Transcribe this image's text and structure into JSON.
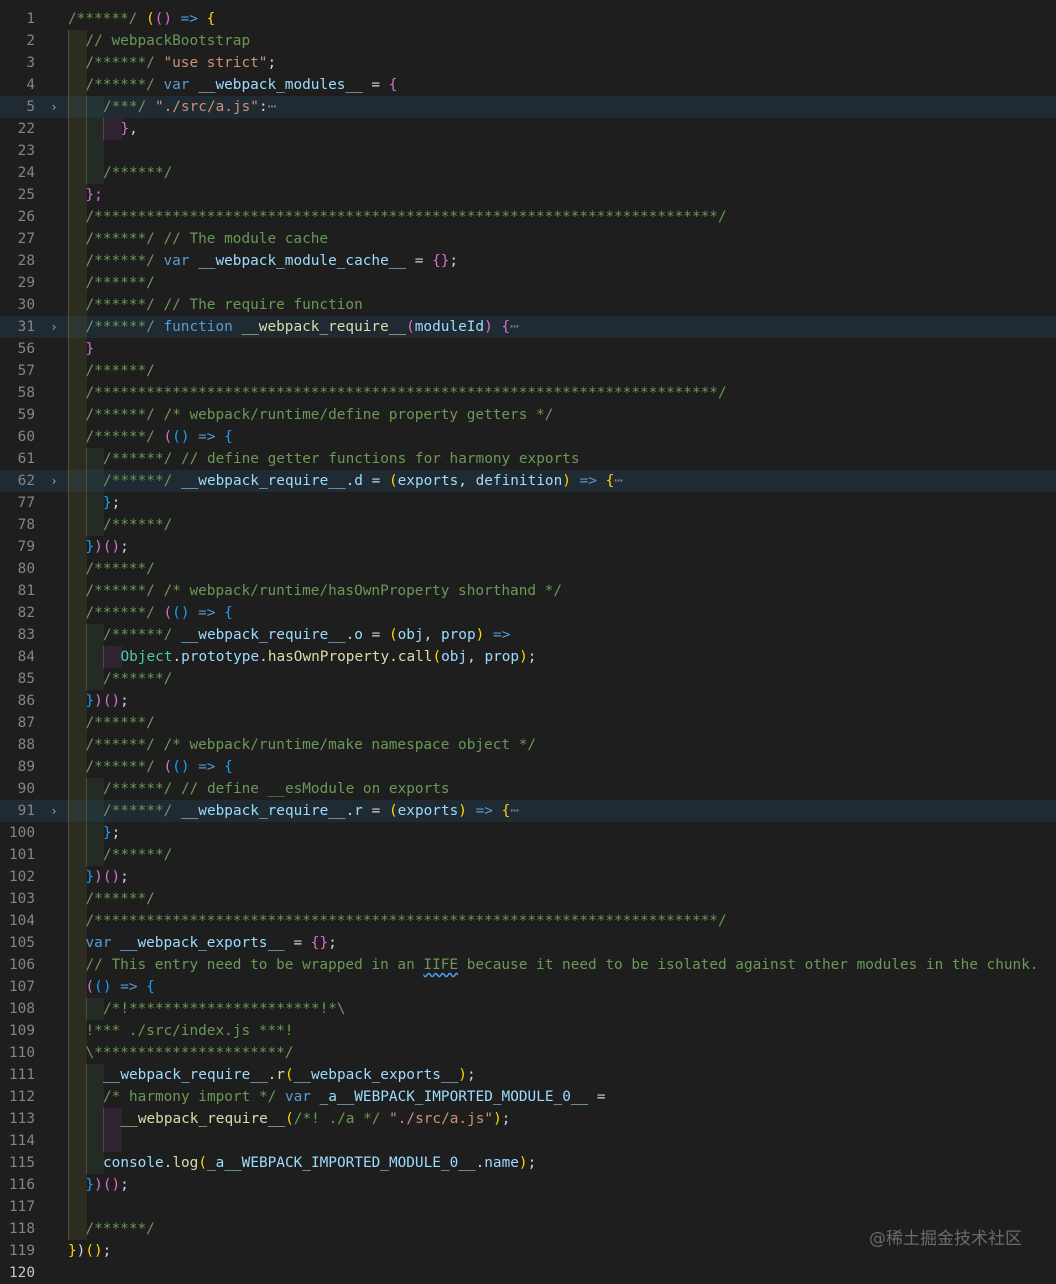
{
  "editor": {
    "lines": [
      {
        "n": "1",
        "fold": false,
        "hl": false,
        "indent": 0,
        "tokens": [
          [
            "/******/ ",
            "cm"
          ],
          [
            "(",
            "p1"
          ],
          [
            "()",
            "p2"
          ],
          [
            " => ",
            "kw"
          ],
          [
            "{",
            "p1"
          ]
        ]
      },
      {
        "n": "2",
        "fold": false,
        "hl": false,
        "indent": 1,
        "tokens": [
          [
            "// webpackBootstrap",
            "cm"
          ]
        ]
      },
      {
        "n": "3",
        "fold": false,
        "hl": false,
        "indent": 1,
        "tokens": [
          [
            "/******/ ",
            "cm"
          ],
          [
            "\"use strict\"",
            "str"
          ],
          [
            ";",
            "op"
          ]
        ]
      },
      {
        "n": "4",
        "fold": false,
        "hl": false,
        "indent": 1,
        "tokens": [
          [
            "/******/ ",
            "cm"
          ],
          [
            "var ",
            "kw"
          ],
          [
            "__webpack_modules__",
            "id"
          ],
          [
            " = ",
            "op"
          ],
          [
            "{",
            "p2"
          ]
        ]
      },
      {
        "n": "5",
        "fold": true,
        "hl": true,
        "indent": 2,
        "tokens": [
          [
            "/***/ ",
            "cm"
          ],
          [
            "\"./src/a.js\"",
            "str"
          ],
          [
            ":",
            "op"
          ],
          [
            "⋯",
            "dim"
          ]
        ]
      },
      {
        "n": "22",
        "fold": false,
        "hl": false,
        "indent": 3,
        "tokens": [
          [
            "}",
            "p2"
          ],
          [
            ",",
            "op"
          ]
        ]
      },
      {
        "n": "23",
        "fold": false,
        "hl": false,
        "indent": 2,
        "tokens": []
      },
      {
        "n": "24",
        "fold": false,
        "hl": false,
        "indent": 2,
        "tokens": [
          [
            "/******/",
            "cm"
          ]
        ]
      },
      {
        "n": "25",
        "fold": false,
        "hl": false,
        "indent": 1,
        "tokens": [
          [
            "};",
            "p2"
          ]
        ]
      },
      {
        "n": "26",
        "fold": false,
        "hl": false,
        "indent": 1,
        "tokens": [
          [
            "/************************************************************************/",
            "cm"
          ]
        ]
      },
      {
        "n": "27",
        "fold": false,
        "hl": false,
        "indent": 1,
        "tokens": [
          [
            "/******/ // The module cache",
            "cm"
          ]
        ]
      },
      {
        "n": "28",
        "fold": false,
        "hl": false,
        "indent": 1,
        "tokens": [
          [
            "/******/ ",
            "cm"
          ],
          [
            "var ",
            "kw"
          ],
          [
            "__webpack_module_cache__",
            "id"
          ],
          [
            " = ",
            "op"
          ],
          [
            "{}",
            "p2"
          ],
          [
            ";",
            "op"
          ]
        ]
      },
      {
        "n": "29",
        "fold": false,
        "hl": false,
        "indent": 1,
        "tokens": [
          [
            "/******/",
            "cm"
          ]
        ]
      },
      {
        "n": "30",
        "fold": false,
        "hl": false,
        "indent": 1,
        "tokens": [
          [
            "/******/ // The require function",
            "cm"
          ]
        ]
      },
      {
        "n": "31",
        "fold": true,
        "hl": true,
        "indent": 1,
        "tokens": [
          [
            "/******/ ",
            "cm"
          ],
          [
            "function ",
            "kw"
          ],
          [
            "__webpack_require__",
            "fn"
          ],
          [
            "(",
            "p2"
          ],
          [
            "moduleId",
            "id"
          ],
          [
            ")",
            "p2"
          ],
          [
            " {",
            "p2"
          ],
          [
            "⋯",
            "dim"
          ]
        ]
      },
      {
        "n": "56",
        "fold": false,
        "hl": false,
        "indent": 1,
        "tokens": [
          [
            "}",
            "p2"
          ]
        ]
      },
      {
        "n": "57",
        "fold": false,
        "hl": false,
        "indent": 1,
        "tokens": [
          [
            "/******/",
            "cm"
          ]
        ]
      },
      {
        "n": "58",
        "fold": false,
        "hl": false,
        "indent": 1,
        "tokens": [
          [
            "/************************************************************************/",
            "cm"
          ]
        ]
      },
      {
        "n": "59",
        "fold": false,
        "hl": false,
        "indent": 1,
        "tokens": [
          [
            "/******/ /* webpack/runtime/define property getters */",
            "cm"
          ]
        ]
      },
      {
        "n": "60",
        "fold": false,
        "hl": false,
        "indent": 1,
        "tokens": [
          [
            "/******/ ",
            "cm"
          ],
          [
            "(",
            "p2"
          ],
          [
            "()",
            "p3"
          ],
          [
            " => ",
            "kw"
          ],
          [
            "{",
            "p3"
          ]
        ]
      },
      {
        "n": "61",
        "fold": false,
        "hl": false,
        "indent": 2,
        "tokens": [
          [
            "/******/ // define getter functions for harmony exports",
            "cm"
          ]
        ]
      },
      {
        "n": "62",
        "fold": true,
        "hl": true,
        "indent": 2,
        "tokens": [
          [
            "/******/ ",
            "cm"
          ],
          [
            "__webpack_require__",
            "id"
          ],
          [
            ".",
            "op"
          ],
          [
            "d",
            "id"
          ],
          [
            " = ",
            "op"
          ],
          [
            "(",
            "p1"
          ],
          [
            "exports",
            "id"
          ],
          [
            ", ",
            "op"
          ],
          [
            "definition",
            "id"
          ],
          [
            ")",
            "p1"
          ],
          [
            " => ",
            "kw"
          ],
          [
            "{",
            "p1"
          ],
          [
            "⋯",
            "dim"
          ]
        ]
      },
      {
        "n": "77",
        "fold": false,
        "hl": false,
        "indent": 2,
        "tokens": [
          [
            "}",
            "p3"
          ],
          [
            ";",
            "op"
          ]
        ]
      },
      {
        "n": "78",
        "fold": false,
        "hl": false,
        "indent": 2,
        "tokens": [
          [
            "/******/",
            "cm"
          ]
        ]
      },
      {
        "n": "79",
        "fold": false,
        "hl": false,
        "indent": 1,
        "tokens": [
          [
            "}",
            "p3"
          ],
          [
            ")",
            "p2"
          ],
          [
            "()",
            "p2"
          ],
          [
            ";",
            "op"
          ]
        ]
      },
      {
        "n": "80",
        "fold": false,
        "hl": false,
        "indent": 1,
        "tokens": [
          [
            "/******/",
            "cm"
          ]
        ]
      },
      {
        "n": "81",
        "fold": false,
        "hl": false,
        "indent": 1,
        "tokens": [
          [
            "/******/ /* webpack/runtime/hasOwnProperty shorthand */",
            "cm"
          ]
        ]
      },
      {
        "n": "82",
        "fold": false,
        "hl": false,
        "indent": 1,
        "tokens": [
          [
            "/******/ ",
            "cm"
          ],
          [
            "(",
            "p2"
          ],
          [
            "()",
            "p3"
          ],
          [
            " => ",
            "kw"
          ],
          [
            "{",
            "p3"
          ]
        ]
      },
      {
        "n": "83",
        "fold": false,
        "hl": false,
        "indent": 2,
        "tokens": [
          [
            "/******/ ",
            "cm"
          ],
          [
            "__webpack_require__",
            "id"
          ],
          [
            ".",
            "op"
          ],
          [
            "o",
            "id"
          ],
          [
            " = ",
            "op"
          ],
          [
            "(",
            "p1"
          ],
          [
            "obj",
            "id"
          ],
          [
            ", ",
            "op"
          ],
          [
            "prop",
            "id"
          ],
          [
            ")",
            "p1"
          ],
          [
            " =>",
            "kw"
          ]
        ]
      },
      {
        "n": "84",
        "fold": false,
        "hl": false,
        "indent": 3,
        "tokens": [
          [
            "Object",
            "ty"
          ],
          [
            ".",
            "op"
          ],
          [
            "prototype",
            "id"
          ],
          [
            ".",
            "op"
          ],
          [
            "hasOwnProperty",
            "fn"
          ],
          [
            ".",
            "op"
          ],
          [
            "call",
            "fn"
          ],
          [
            "(",
            "p1"
          ],
          [
            "obj",
            "id"
          ],
          [
            ", ",
            "op"
          ],
          [
            "prop",
            "id"
          ],
          [
            ")",
            "p1"
          ],
          [
            ";",
            "op"
          ]
        ]
      },
      {
        "n": "85",
        "fold": false,
        "hl": false,
        "indent": 2,
        "tokens": [
          [
            "/******/",
            "cm"
          ]
        ]
      },
      {
        "n": "86",
        "fold": false,
        "hl": false,
        "indent": 1,
        "tokens": [
          [
            "}",
            "p3"
          ],
          [
            ")",
            "p2"
          ],
          [
            "()",
            "p2"
          ],
          [
            ";",
            "op"
          ]
        ]
      },
      {
        "n": "87",
        "fold": false,
        "hl": false,
        "indent": 1,
        "tokens": [
          [
            "/******/",
            "cm"
          ]
        ]
      },
      {
        "n": "88",
        "fold": false,
        "hl": false,
        "indent": 1,
        "tokens": [
          [
            "/******/ /* webpack/runtime/make namespace object */",
            "cm"
          ]
        ]
      },
      {
        "n": "89",
        "fold": false,
        "hl": false,
        "indent": 1,
        "tokens": [
          [
            "/******/ ",
            "cm"
          ],
          [
            "(",
            "p2"
          ],
          [
            "()",
            "p3"
          ],
          [
            " => ",
            "kw"
          ],
          [
            "{",
            "p3"
          ]
        ]
      },
      {
        "n": "90",
        "fold": false,
        "hl": false,
        "indent": 2,
        "tokens": [
          [
            "/******/ // define __esModule on exports",
            "cm"
          ]
        ]
      },
      {
        "n": "91",
        "fold": true,
        "hl": true,
        "indent": 2,
        "tokens": [
          [
            "/******/ ",
            "cm"
          ],
          [
            "__webpack_require__",
            "id"
          ],
          [
            ".",
            "op"
          ],
          [
            "r",
            "id"
          ],
          [
            " = ",
            "op"
          ],
          [
            "(",
            "p1"
          ],
          [
            "exports",
            "id"
          ],
          [
            ")",
            "p1"
          ],
          [
            " => ",
            "kw"
          ],
          [
            "{",
            "p1"
          ],
          [
            "⋯",
            "dim"
          ]
        ]
      },
      {
        "n": "100",
        "fold": false,
        "hl": false,
        "indent": 2,
        "tokens": [
          [
            "}",
            "p3"
          ],
          [
            ";",
            "op"
          ]
        ]
      },
      {
        "n": "101",
        "fold": false,
        "hl": false,
        "indent": 2,
        "tokens": [
          [
            "/******/",
            "cm"
          ]
        ]
      },
      {
        "n": "102",
        "fold": false,
        "hl": false,
        "indent": 1,
        "tokens": [
          [
            "}",
            "p3"
          ],
          [
            ")",
            "p2"
          ],
          [
            "()",
            "p2"
          ],
          [
            ";",
            "op"
          ]
        ]
      },
      {
        "n": "103",
        "fold": false,
        "hl": false,
        "indent": 1,
        "tokens": [
          [
            "/******/",
            "cm"
          ]
        ]
      },
      {
        "n": "104",
        "fold": false,
        "hl": false,
        "indent": 1,
        "tokens": [
          [
            "/************************************************************************/",
            "cm"
          ]
        ]
      },
      {
        "n": "105",
        "fold": false,
        "hl": false,
        "indent": 1,
        "tokens": [
          [
            "var ",
            "kw"
          ],
          [
            "__webpack_exports__",
            "id"
          ],
          [
            " = ",
            "op"
          ],
          [
            "{}",
            "p2"
          ],
          [
            ";",
            "op"
          ]
        ]
      },
      {
        "n": "106",
        "fold": false,
        "hl": false,
        "indent": 1,
        "tokens": [
          [
            "// This entry need to be wrapped in an ",
            "cm"
          ],
          [
            "IIFE",
            "cm squig"
          ],
          [
            " because it need to be isolated against other modules in the chunk.",
            "cm"
          ]
        ]
      },
      {
        "n": "107",
        "fold": false,
        "hl": false,
        "indent": 1,
        "tokens": [
          [
            "(",
            "p2"
          ],
          [
            "()",
            "p3"
          ],
          [
            " => ",
            "kw"
          ],
          [
            "{",
            "p3"
          ]
        ]
      },
      {
        "n": "108",
        "fold": false,
        "hl": false,
        "indent": 2,
        "tokens": [
          [
            "/*!**********************!*\\",
            "cm"
          ]
        ]
      },
      {
        "n": "109",
        "fold": false,
        "hl": false,
        "indent": 1,
        "tokens": [
          [
            "!*** ./src/index.js ***!",
            "cm"
          ]
        ]
      },
      {
        "n": "110",
        "fold": false,
        "hl": false,
        "indent": 1,
        "tokens": [
          [
            "\\**********************/",
            "cm"
          ]
        ]
      },
      {
        "n": "111",
        "fold": false,
        "hl": false,
        "indent": 2,
        "tokens": [
          [
            "__webpack_require__",
            "id"
          ],
          [
            ".",
            "op"
          ],
          [
            "r",
            "fn"
          ],
          [
            "(",
            "p1"
          ],
          [
            "__webpack_exports__",
            "id"
          ],
          [
            ")",
            "p1"
          ],
          [
            ";",
            "op"
          ]
        ]
      },
      {
        "n": "112",
        "fold": false,
        "hl": false,
        "indent": 2,
        "tokens": [
          [
            "/* harmony import */ ",
            "cm"
          ],
          [
            "var ",
            "kw"
          ],
          [
            "_a__WEBPACK_IMPORTED_MODULE_0__",
            "id"
          ],
          [
            " =",
            "op"
          ]
        ]
      },
      {
        "n": "113",
        "fold": false,
        "hl": false,
        "indent": 3,
        "tokens": [
          [
            "__webpack_require__",
            "fn"
          ],
          [
            "(",
            "p1"
          ],
          [
            "/*! ./a */ ",
            "cm"
          ],
          [
            "\"./src/a.js\"",
            "str"
          ],
          [
            ")",
            "p1"
          ],
          [
            ";",
            "op"
          ]
        ]
      },
      {
        "n": "114",
        "fold": false,
        "hl": false,
        "indent": 3,
        "tokens": []
      },
      {
        "n": "115",
        "fold": false,
        "hl": false,
        "indent": 2,
        "tokens": [
          [
            "console",
            "id"
          ],
          [
            ".",
            "op"
          ],
          [
            "log",
            "fn"
          ],
          [
            "(",
            "p1"
          ],
          [
            "_a__WEBPACK_IMPORTED_MODULE_0__",
            "id"
          ],
          [
            ".",
            "op"
          ],
          [
            "name",
            "id"
          ],
          [
            ")",
            "p1"
          ],
          [
            ";",
            "op"
          ]
        ]
      },
      {
        "n": "116",
        "fold": false,
        "hl": false,
        "indent": 1,
        "tokens": [
          [
            "}",
            "p3"
          ],
          [
            ")",
            "p2"
          ],
          [
            "()",
            "p2"
          ],
          [
            ";",
            "op"
          ]
        ]
      },
      {
        "n": "117",
        "fold": false,
        "hl": false,
        "indent": 1,
        "tokens": []
      },
      {
        "n": "118",
        "fold": false,
        "hl": false,
        "indent": 1,
        "tokens": [
          [
            "/******/",
            "cm"
          ]
        ]
      },
      {
        "n": "119",
        "fold": false,
        "hl": false,
        "indent": 0,
        "tokens": [
          [
            "}",
            "p1"
          ],
          [
            ")",
            "op"
          ],
          [
            "()",
            "p1"
          ],
          [
            ";",
            "op"
          ]
        ]
      },
      {
        "n": "120",
        "fold": false,
        "hl": false,
        "indent": 0,
        "tokens": []
      }
    ]
  },
  "icons": {
    "fold": "chevron-right-icon",
    "fold_glyph": "›"
  },
  "watermark": {
    "text": "@稀土掘金技术社区"
  }
}
